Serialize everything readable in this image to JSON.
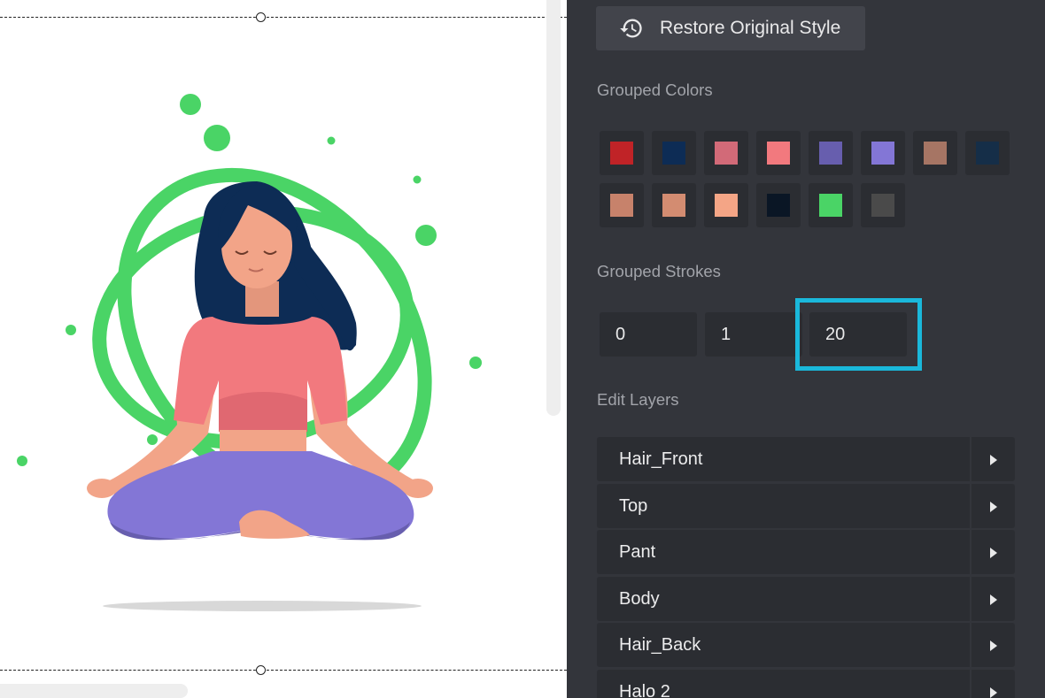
{
  "panel": {
    "restore_button": {
      "label": "Restore Original Style",
      "icon": "history-icon"
    },
    "grouped_colors": {
      "title": "Grouped Colors",
      "swatches": [
        "#c02327",
        "#0d2c55",
        "#d26a78",
        "#f2797e",
        "#675eae",
        "#8376d6",
        "#a67564",
        "#152e48",
        "#c7826b",
        "#d38c71",
        "#f4a586",
        "#0a1625",
        "#4ad466",
        "#4a4a4a"
      ]
    },
    "grouped_strokes": {
      "title": "Grouped Strokes",
      "values": [
        "0",
        "1",
        "20"
      ]
    },
    "edit_layers": {
      "title": "Edit Layers",
      "layers": [
        "Hair_Front",
        "Top",
        "Pant",
        "Body",
        "Hair_Back",
        "Halo 2"
      ]
    }
  },
  "theme": {
    "panel_bg": "#33353b",
    "field_bg": "#2b2d32",
    "highlight": "#1ab8db",
    "halo_green": "#4ad466"
  }
}
